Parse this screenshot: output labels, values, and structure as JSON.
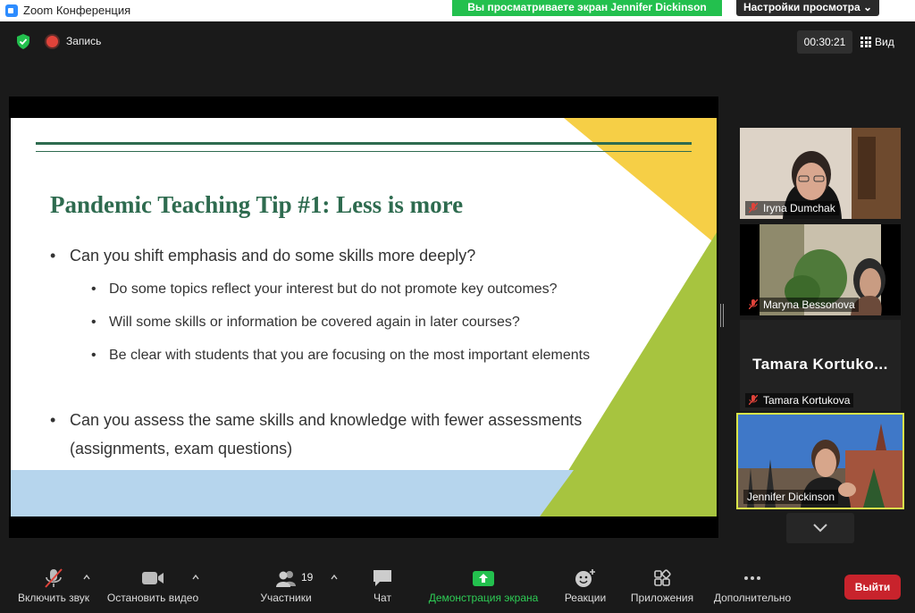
{
  "window": {
    "title": "Zoom Конференция"
  },
  "banner": {
    "viewing": "Вы просматриваете экран Jennifer Dickinson",
    "view_options": "Настройки просмотра ⌄"
  },
  "topbar": {
    "record_label": "Запись",
    "timer": "00:30:21",
    "view_label": "Вид"
  },
  "slide": {
    "title": "Pandemic Teaching Tip #1:  Less is more",
    "bullets": [
      "Can you shift emphasis and do some skills more deeply?",
      "Can you assess the same skills and knowledge with fewer assessments (assignments, exam questions)"
    ],
    "subbullets": [
      "Do some topics reflect your interest but do not promote key outcomes?",
      "Will some skills or information be covered again in later courses?",
      "Be clear with students that you are focusing on the most important elements"
    ]
  },
  "participants": [
    {
      "name": "Iryna Dumchak",
      "muted": true
    },
    {
      "name": "Maryna Bessonova",
      "muted": true
    },
    {
      "name": "Tamara Kortukova",
      "display": "Tamara  Kortuko...",
      "muted": true
    },
    {
      "name": "Jennifer Dickinson",
      "muted": false
    }
  ],
  "toolbar": {
    "audio": "Включить звук",
    "video": "Остановить видео",
    "participants": "Участники",
    "participants_count": "19",
    "chat": "Чат",
    "share": "Демонстрация экрана",
    "reactions": "Реакции",
    "apps": "Приложения",
    "more": "Дополнительно",
    "leave": "Выйти"
  },
  "colors": {
    "slide_green": "#2e6b4f",
    "share_green": "#23c04e",
    "leave_red": "#c8232c",
    "active_speaker": "#d9e54a"
  }
}
